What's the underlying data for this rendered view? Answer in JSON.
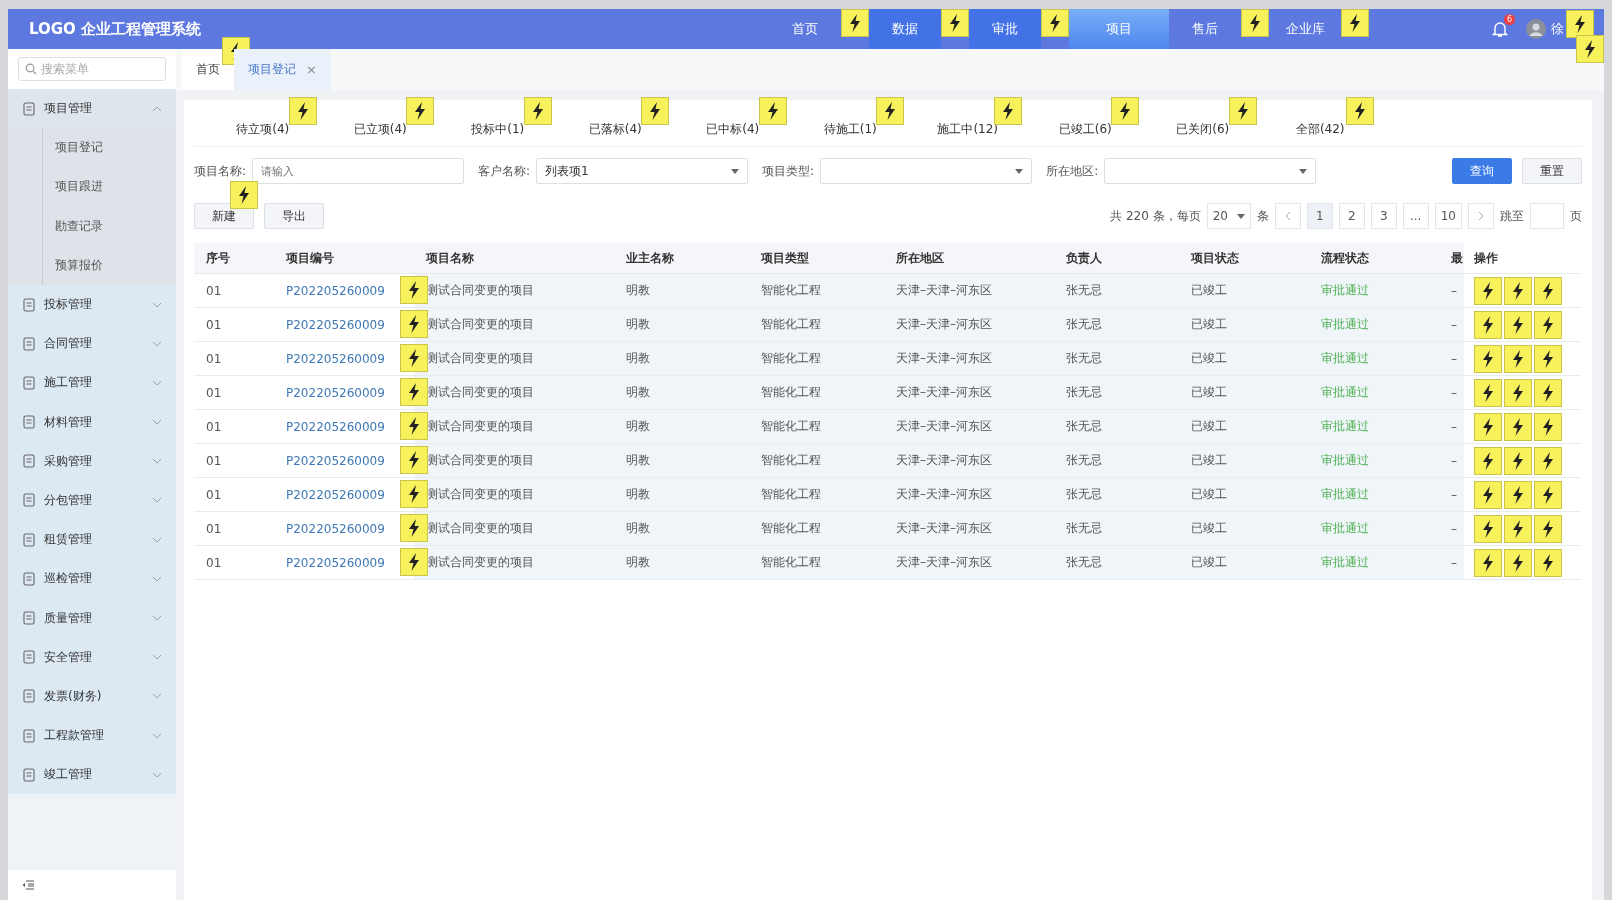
{
  "header": {
    "logo": "LOGO 企业工程管理系统",
    "nav": [
      {
        "label": "首页",
        "selected": false,
        "highlighted": false,
        "marker": true
      },
      {
        "label": "数据",
        "selected": false,
        "highlighted": true,
        "marker": true
      },
      {
        "label": "审批",
        "selected": false,
        "highlighted": true,
        "marker": true
      },
      {
        "label": "项目",
        "selected": true,
        "highlighted": false,
        "marker": false
      },
      {
        "label": "售后",
        "selected": false,
        "highlighted": false,
        "marker": true
      },
      {
        "label": "企业库",
        "selected": false,
        "highlighted": false,
        "marker": true
      }
    ],
    "notification_count": "6",
    "user_name": "徐"
  },
  "sidebar": {
    "search_placeholder": "搜索菜单",
    "items": [
      {
        "label": "项目管理",
        "expanded": true,
        "children": [
          {
            "label": "项目登记"
          },
          {
            "label": "项目跟进"
          },
          {
            "label": "勘查记录"
          },
          {
            "label": "预算报价"
          }
        ]
      },
      {
        "label": "投标管理",
        "expanded": false
      },
      {
        "label": "合同管理",
        "expanded": false
      },
      {
        "label": "施工管理",
        "expanded": false
      },
      {
        "label": "材料管理",
        "expanded": false
      },
      {
        "label": "采购管理",
        "expanded": false
      },
      {
        "label": "分包管理",
        "expanded": false
      },
      {
        "label": "租赁管理",
        "expanded": false
      },
      {
        "label": "巡检管理",
        "expanded": false
      },
      {
        "label": "质量管理",
        "expanded": false
      },
      {
        "label": "安全管理",
        "expanded": false
      },
      {
        "label": "发票(财务)",
        "expanded": false
      },
      {
        "label": "工程款管理",
        "expanded": false
      },
      {
        "label": "竣工管理",
        "expanded": false
      }
    ]
  },
  "page_tabs": [
    {
      "label": "首页",
      "selected": false
    },
    {
      "label": "项目登记",
      "selected": true,
      "close": "×"
    }
  ],
  "status_tabs": [
    {
      "label": "待立项(4)",
      "selected": false
    },
    {
      "label": "已立项(4)",
      "selected": false
    },
    {
      "label": "投标中(1)",
      "selected": false
    },
    {
      "label": "已落标(4)",
      "selected": false
    },
    {
      "label": "已中标(4)",
      "selected": false
    },
    {
      "label": "待施工(1)",
      "selected": false
    },
    {
      "label": "施工中(12)",
      "selected": false
    },
    {
      "label": "已竣工(6)",
      "selected": false
    },
    {
      "label": "已关闭(6)",
      "selected": false
    },
    {
      "label": "全部(42)",
      "selected": false
    }
  ],
  "filters": [
    {
      "kind": "text",
      "label": "项目名称:",
      "placeholder": "请输入"
    },
    {
      "kind": "select",
      "label": "客户名称:",
      "value": "列表项1"
    },
    {
      "kind": "select",
      "label": "项目类型:"
    },
    {
      "kind": "select",
      "label": "所在地区:"
    }
  ],
  "filter_buttons": [
    {
      "label": "查询",
      "kind": "primary"
    },
    {
      "label": "重置",
      "kind": "default"
    }
  ],
  "toolbar": [
    "新建",
    "导出"
  ],
  "pagination": {
    "total": "共 220 条，每页",
    "page_size": "20",
    "unit": "条",
    "pages": [
      {
        "label": "1",
        "selected": true
      },
      {
        "label": "2",
        "selected": false
      },
      {
        "label": "3",
        "selected": false
      },
      {
        "label": "...",
        "selected": false
      },
      {
        "label": "10",
        "selected": false
      }
    ],
    "jump_label": "跳至",
    "page_unit": "页"
  },
  "table": {
    "columns": [
      "序号",
      "项目编号",
      "项目名称",
      "业主名称",
      "项目类型",
      "所在地区",
      "负责人",
      "项目状态",
      "流程状态",
      "最",
      "操作"
    ],
    "rows": [
      [
        "01",
        "P202205260009",
        "测试合同变更的项目",
        "明教",
        "智能化工程",
        "天津–天津–河东区",
        "张无忌",
        "已竣工",
        "审批通过",
        "–"
      ],
      [
        "01",
        "P202205260009",
        "测试合同变更的项目",
        "明教",
        "智能化工程",
        "天津–天津–河东区",
        "张无忌",
        "已竣工",
        "审批通过",
        "–"
      ],
      [
        "01",
        "P202205260009",
        "测试合同变更的项目",
        "明教",
        "智能化工程",
        "天津–天津–河东区",
        "张无忌",
        "已竣工",
        "审批通过",
        "–"
      ],
      [
        "01",
        "P202205260009",
        "测试合同变更的项目",
        "明教",
        "智能化工程",
        "天津–天津–河东区",
        "张无忌",
        "已竣工",
        "审批通过",
        "–"
      ],
      [
        "01",
        "P202205260009",
        "测试合同变更的项目",
        "明教",
        "智能化工程",
        "天津–天津–河东区",
        "张无忌",
        "已竣工",
        "审批通过",
        "–"
      ],
      [
        "01",
        "P202205260009",
        "测试合同变更的项目",
        "明教",
        "智能化工程",
        "天津–天津–河东区",
        "张无忌",
        "已竣工",
        "审批通过",
        "–"
      ],
      [
        "01",
        "P202205260009",
        "测试合同变更的项目",
        "明教",
        "智能化工程",
        "天津–天津–河东区",
        "张无忌",
        "已竣工",
        "审批通过",
        "–"
      ],
      [
        "01",
        "P202205260009",
        "测试合同变更的项目",
        "明教",
        "智能化工程",
        "天津–天津–河东区",
        "张无忌",
        "已竣工",
        "审批通过",
        "–"
      ],
      [
        "01",
        "P202205260009",
        "测试合同变更的项目",
        "明教",
        "智能化工程",
        "天津–天津–河东区",
        "张无忌",
        "已竣工",
        "审批通过",
        "–"
      ]
    ]
  }
}
